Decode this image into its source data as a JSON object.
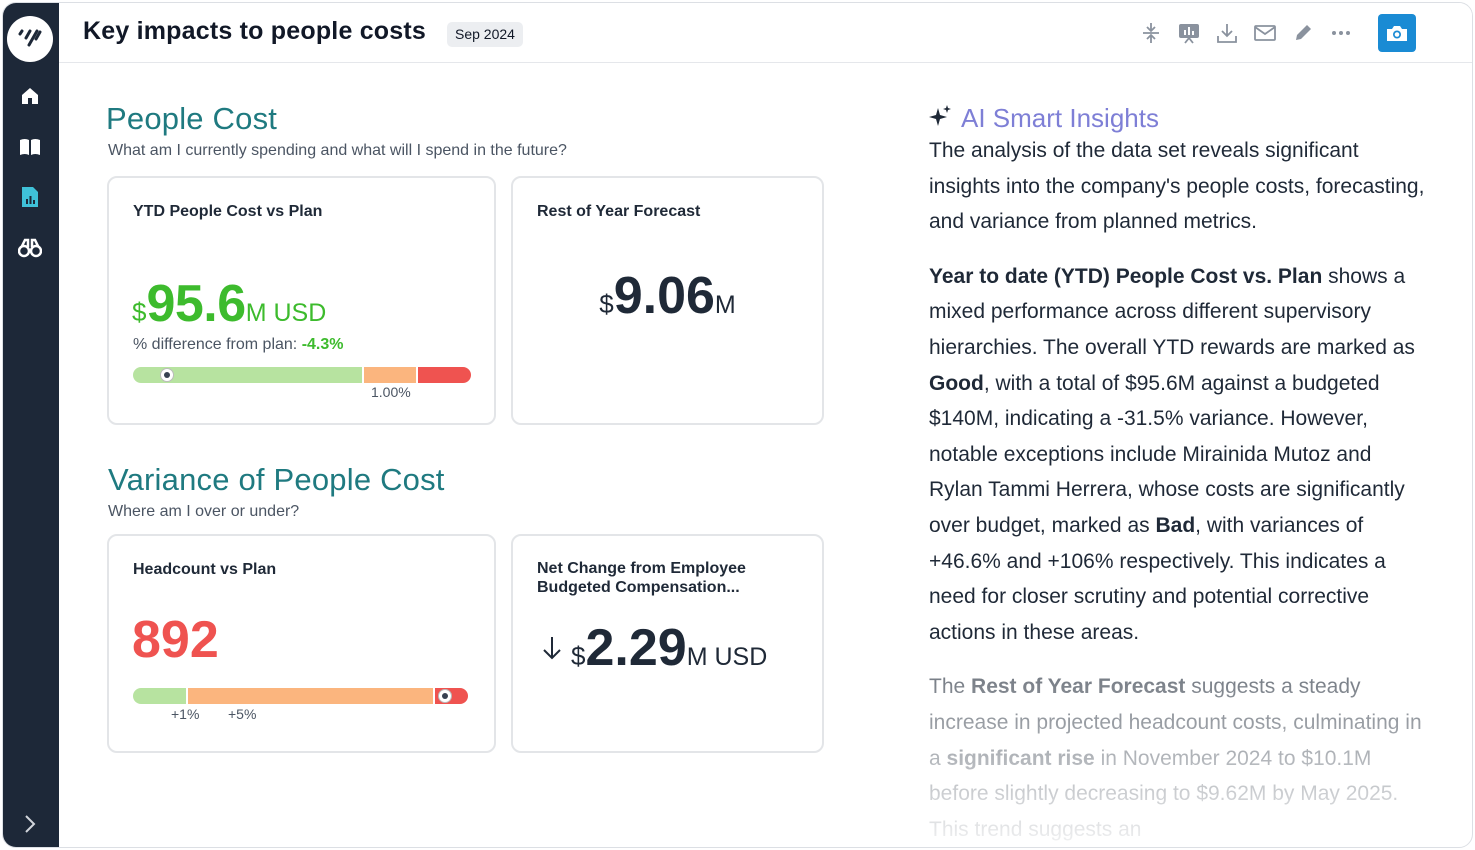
{
  "header": {
    "title": "Key impacts to people costs",
    "date_badge": "Sep 2024"
  },
  "sidebar": {
    "items": [
      {
        "name": "home-icon"
      },
      {
        "name": "book-icon"
      },
      {
        "name": "report-icon"
      },
      {
        "name": "binoculars-icon"
      }
    ]
  },
  "people_cost": {
    "title": "People Cost",
    "subtitle": "What am I currently spending and what will I spend in the future?",
    "ytd_card": {
      "title": "YTD People Cost vs Plan",
      "currency": "$",
      "value": "95.6",
      "unit": "M USD",
      "pct_label": "% difference from plan:",
      "pct_value": "-4.3%",
      "bar_tick": "1.00%",
      "marker_fraction": 0.1
    },
    "forecast_card": {
      "title": "Rest of Year Forecast",
      "currency": "$",
      "value": "9.06",
      "unit": "M"
    }
  },
  "variance": {
    "title": "Variance of People Cost",
    "subtitle": "Where am I over or under?",
    "headcount_card": {
      "title": "Headcount vs Plan",
      "value": "892",
      "tick1": "+1%",
      "tick2": "+5%",
      "marker_fraction": 0.935
    },
    "net_card": {
      "title_line1": "Net Change from Employee",
      "title_line2": "Budgeted Compensation...",
      "currency": "$",
      "value": "2.29",
      "unit": "M USD"
    }
  },
  "ai": {
    "title": "AI Smart Insights",
    "p1": "The analysis of the data set reveals significant insights into the company's people costs, forecasting, and variance from planned metrics.",
    "p2_b1": "Year to date (YTD) People Cost vs. Plan",
    "p2_t1": " shows a mixed performance across different supervisory hierarchies. The overall YTD rewards are marked as ",
    "p2_b2": "Good",
    "p2_t2": ", with a total of $95.6M against a budgeted $140M, indicating a -31.5% variance. However, notable exceptions include Mirainida Mutoz and Rylan Tammi Herrera, whose costs are significantly over budget, marked as ",
    "p2_b3": "Bad",
    "p2_t3": ", with variances of +46.6% and +106% respectively. This indicates a need for closer scrutiny and potential corrective actions in these areas.",
    "p3_t0": "The ",
    "p3_b1": "Rest of Year Forecast",
    "p3_t1": " suggests a steady increase in projected headcount costs, culminating in a ",
    "p3_b2": "significant rise",
    "p3_t2": " in November 2024 to $10.1M before slightly decreasing to $9.62M by May 2025. This trend suggests an"
  },
  "colors": {
    "sidebar_bg": "#1d2838",
    "accent_teal": "#1f7a80",
    "good_green": "#3dbb2d",
    "bad_red": "#ef5350",
    "ai_purple": "#7e7fd6",
    "camera_blue": "#1a8bd4"
  }
}
